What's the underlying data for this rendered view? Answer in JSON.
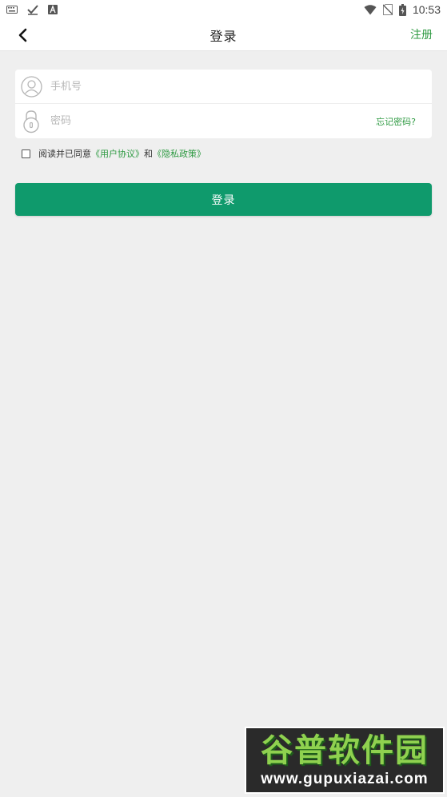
{
  "status_bar": {
    "time": "10:53",
    "icons": [
      "keyboard-icon",
      "check-icon",
      "a-icon",
      "wifi-icon",
      "no-sim-icon",
      "battery-icon"
    ]
  },
  "header": {
    "title": "登录",
    "register_label": "注册"
  },
  "form": {
    "phone_placeholder": "手机号",
    "phone_value": "",
    "password_placeholder": "密码",
    "password_value": "",
    "forgot_label": "忘记密码?"
  },
  "agreement": {
    "checked": false,
    "prefix": "阅读并已同意",
    "user_agreement": "《用户协议》",
    "conjunction": "和",
    "privacy_policy": "《隐私政策》"
  },
  "login_button_label": "登录",
  "watermark": {
    "title": "谷普软件园",
    "url": "www.gupuxiazai.com"
  },
  "colors": {
    "accent_green": "#2e9a42",
    "button_green": "#0f9a6c",
    "background": "#efefef"
  }
}
